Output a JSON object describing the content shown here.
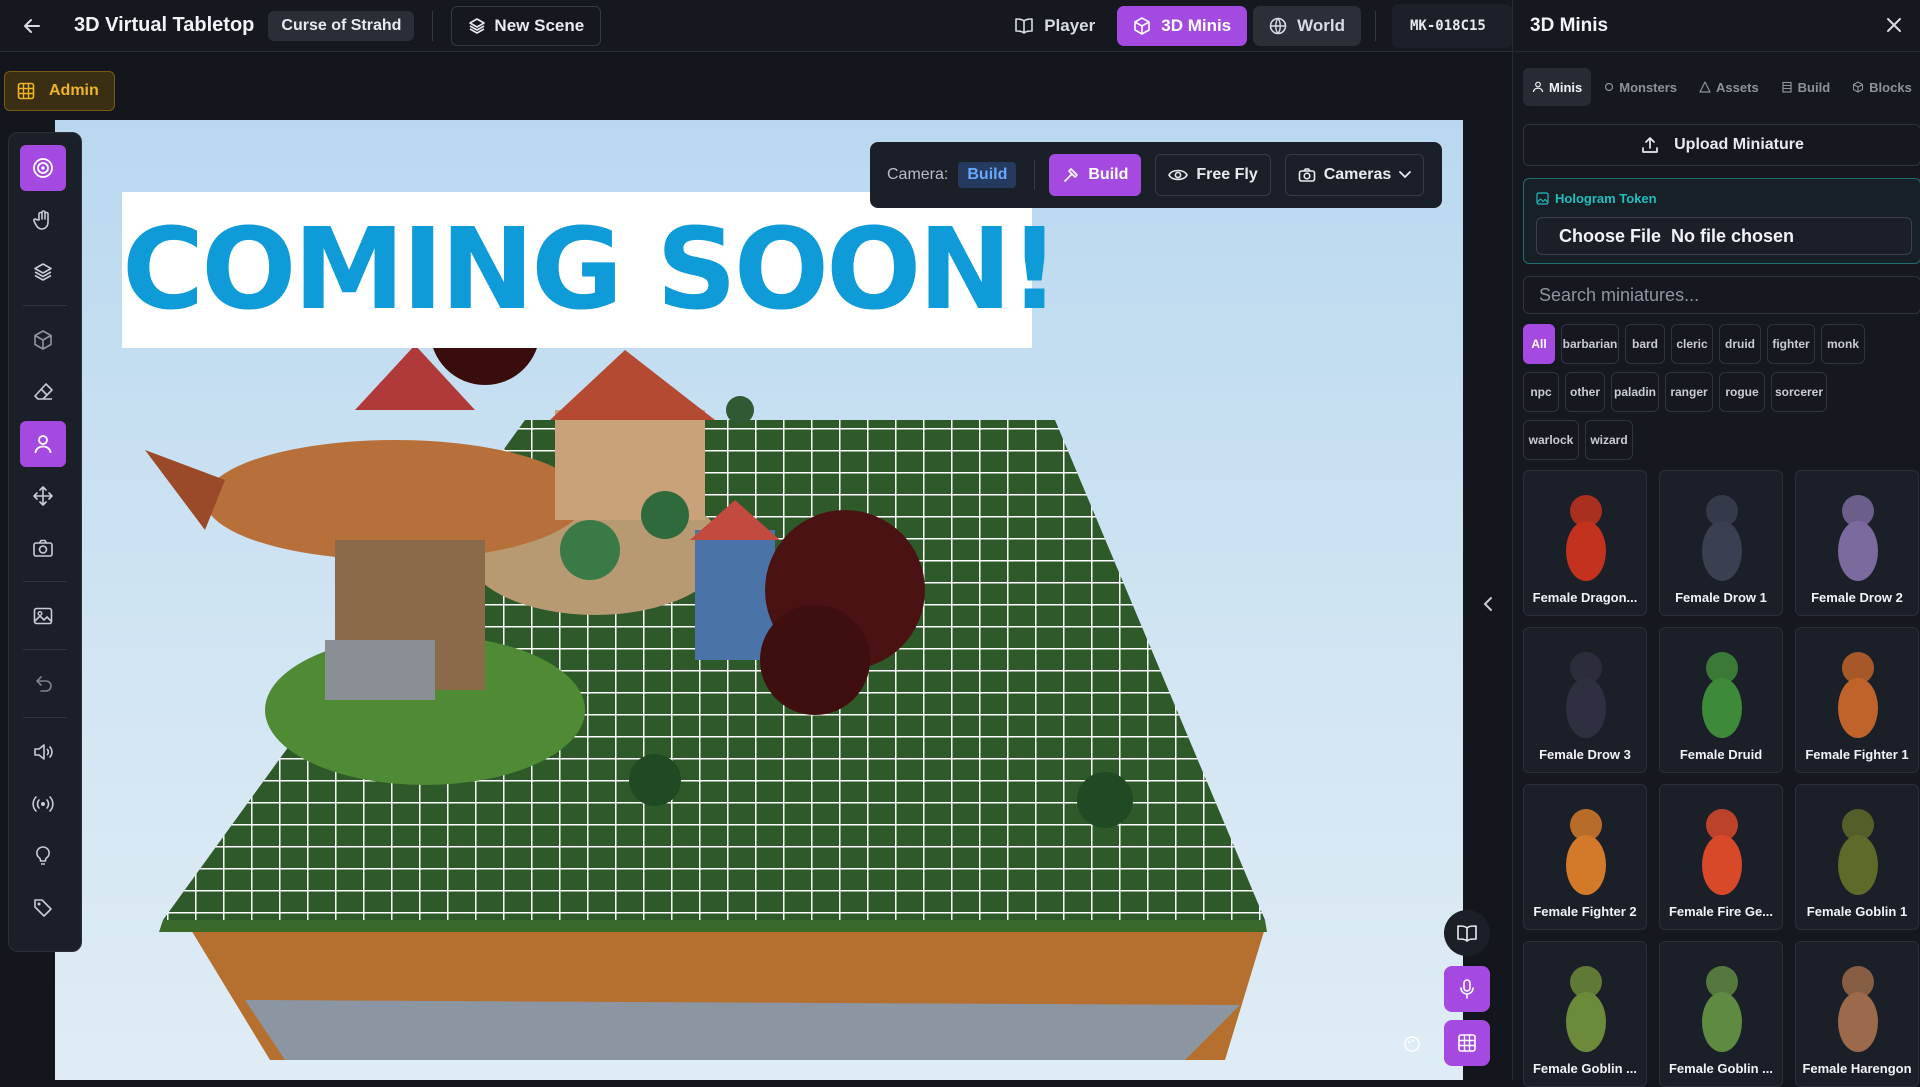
{
  "topbar": {
    "app_title": "3D Virtual Tabletop",
    "campaign": "Curse of Strahd",
    "new_scene": "New Scene",
    "modes": [
      "Player",
      "3D Minis",
      "World"
    ],
    "session_id": "MK-018C15"
  },
  "admin": {
    "label": "Admin"
  },
  "toolbar": {
    "tools": [
      "target",
      "hand",
      "layers",
      "cube",
      "eraser",
      "person",
      "move",
      "camera",
      "image",
      "undo",
      "volume",
      "broadcast",
      "lightbulb",
      "tag"
    ],
    "active": [
      "target",
      "person"
    ]
  },
  "viewport": {
    "camera_label": "Camera:",
    "camera_mode": "Build",
    "buttons": [
      "Build",
      "Free Fly",
      "Cameras"
    ],
    "banner": "COMING SOON!"
  },
  "panel": {
    "title": "3D Minis",
    "tabs": [
      "Minis",
      "Monsters",
      "Assets",
      "Build",
      "Blocks"
    ],
    "upload": "Upload Miniature",
    "hologram_label": "Hologram Token",
    "choose_file": "Choose File",
    "no_file": "No file chosen",
    "search_placeholder": "Search miniatures...",
    "filters": [
      "All",
      "barbarian",
      "bard",
      "cleric",
      "druid",
      "fighter",
      "monk",
      "npc",
      "other",
      "paladin",
      "ranger",
      "rogue",
      "sorcerer",
      "warlock",
      "wizard"
    ],
    "active_filter": "All",
    "minis": [
      {
        "name": "Female Dragon...",
        "color": "#c2321f"
      },
      {
        "name": "Female Drow 1",
        "color": "#3a3f52"
      },
      {
        "name": "Female Drow 2",
        "color": "#7a6a9e"
      },
      {
        "name": "Female Drow 3",
        "color": "#2e3042"
      },
      {
        "name": "Female Druid",
        "color": "#3f8a3a"
      },
      {
        "name": "Female Fighter 1",
        "color": "#c0632a"
      },
      {
        "name": "Female Fighter 2",
        "color": "#d27a2a"
      },
      {
        "name": "Female Fire Ge...",
        "color": "#d8492a"
      },
      {
        "name": "Female Goblin 1",
        "color": "#5e6a2a"
      },
      {
        "name": "Female Goblin ...",
        "color": "#6b8a3a"
      },
      {
        "name": "Female Goblin ...",
        "color": "#5f8a42"
      },
      {
        "name": "Female Harengon",
        "color": "#9a6a4a"
      }
    ]
  },
  "colors": {
    "accent": "#a44ae0",
    "admin": "#f0b429",
    "banner": "#0f9ad8",
    "hologram": "#1fbfbf"
  }
}
